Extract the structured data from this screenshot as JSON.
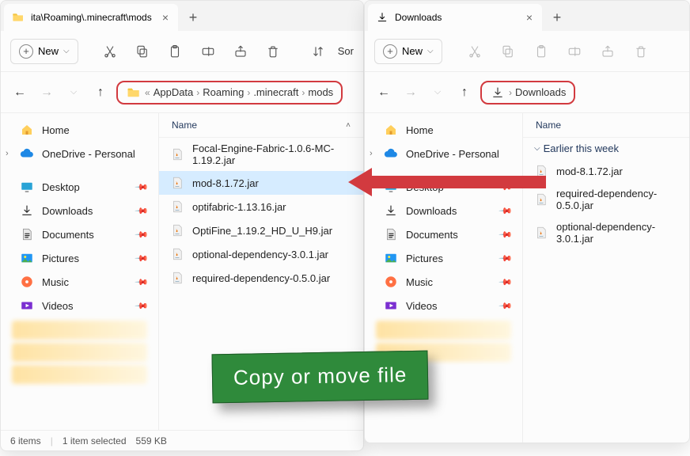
{
  "left": {
    "tab_title": "ita\\Roaming\\.minecraft\\mods",
    "new_label": "New",
    "sort_label": "Sor",
    "breadcrumb": [
      "AppData",
      "Roaming",
      ".minecraft",
      "mods"
    ],
    "col_name": "Name",
    "sidebar": {
      "home": "Home",
      "onedrive": "OneDrive - Personal",
      "desktop": "Desktop",
      "downloads": "Downloads",
      "documents": "Documents",
      "pictures": "Pictures",
      "music": "Music",
      "videos": "Videos"
    },
    "files": [
      "Focal-Engine-Fabric-1.0.6-MC-1.19.2.jar",
      "mod-8.1.72.jar",
      "optifabric-1.13.16.jar",
      "OptiFine_1.19.2_HD_U_H9.jar",
      "optional-dependency-3.0.1.jar",
      "required-dependency-0.5.0.jar"
    ],
    "selected_index": 1,
    "status_items": "6 items",
    "status_selected": "1 item selected",
    "status_size": "559 KB"
  },
  "right": {
    "tab_title": "Downloads",
    "new_label": "New",
    "breadcrumb_label": "Downloads",
    "col_name": "Name",
    "group_label": "Earlier this week",
    "sidebar": {
      "home": "Home",
      "onedrive": "OneDrive - Personal",
      "desktop": "Desktop",
      "downloads": "Downloads",
      "documents": "Documents",
      "pictures": "Pictures",
      "music": "Music",
      "videos": "Videos"
    },
    "files": [
      "mod-8.1.72.jar",
      "required-dependency-0.5.0.jar",
      "optional-dependency-3.0.1.jar"
    ]
  },
  "banner_text": "Copy or move file"
}
